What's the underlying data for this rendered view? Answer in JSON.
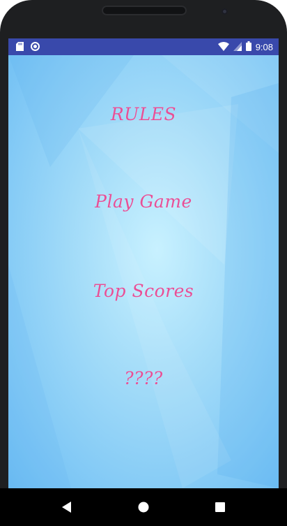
{
  "status_bar": {
    "time": "9:08",
    "left_icons": [
      "sd-card-icon",
      "sync-icon"
    ],
    "right_icons": [
      "wifi-icon",
      "signal-icon",
      "battery-icon"
    ]
  },
  "menu": {
    "items": [
      {
        "label": "RULES"
      },
      {
        "label": "Play Game"
      },
      {
        "label": "Top Scores"
      },
      {
        "label": "????"
      }
    ]
  },
  "nav_bar": {
    "buttons": [
      "back-icon",
      "home-icon",
      "recents-icon"
    ]
  },
  "colors": {
    "status_bar": "#3949ab",
    "menu_text": "#e84f96",
    "background": "#9fd8f8"
  }
}
